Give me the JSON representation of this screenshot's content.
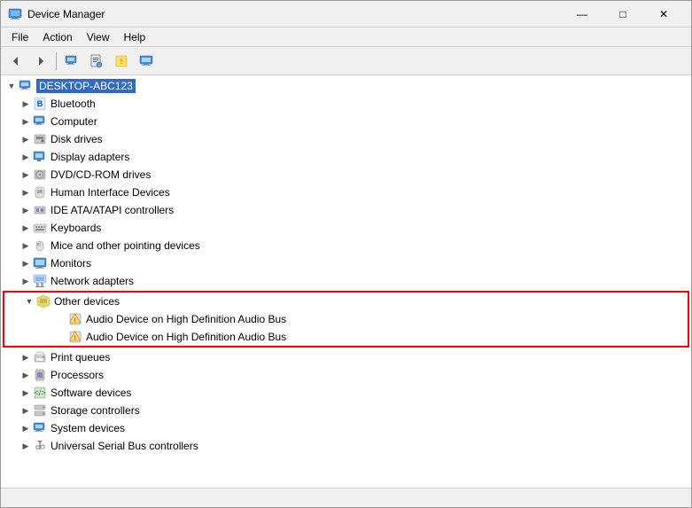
{
  "window": {
    "title": "Device Manager",
    "icon": "device-manager-icon"
  },
  "title_buttons": {
    "minimize": "—",
    "maximize": "□",
    "close": "✕"
  },
  "menu": {
    "items": [
      "File",
      "Action",
      "View",
      "Help"
    ]
  },
  "toolbar": {
    "buttons": [
      {
        "name": "back-btn",
        "icon": "◀"
      },
      {
        "name": "forward-btn",
        "icon": "▶"
      },
      {
        "name": "device-manager-btn",
        "icon": "🖥"
      },
      {
        "name": "properties-btn",
        "icon": "ℹ"
      },
      {
        "name": "update-driver-btn",
        "icon": "📋"
      },
      {
        "name": "monitor-btn",
        "icon": "🖥"
      }
    ]
  },
  "tree": {
    "root": "DESKTOP-ABC123",
    "items": [
      {
        "id": "bluetooth",
        "label": "Bluetooth",
        "level": 1,
        "expanded": false,
        "icon": "bluetooth"
      },
      {
        "id": "computer",
        "label": "Computer",
        "level": 1,
        "expanded": false,
        "icon": "computer"
      },
      {
        "id": "disk-drives",
        "label": "Disk drives",
        "level": 1,
        "expanded": false,
        "icon": "disk"
      },
      {
        "id": "display-adapters",
        "label": "Display adapters",
        "level": 1,
        "expanded": false,
        "icon": "display"
      },
      {
        "id": "dvd-cdrom",
        "label": "DVD/CD-ROM drives",
        "level": 1,
        "expanded": false,
        "icon": "dvd"
      },
      {
        "id": "hid",
        "label": "Human Interface Devices",
        "level": 1,
        "expanded": false,
        "icon": "hid"
      },
      {
        "id": "ide",
        "label": "IDE ATA/ATAPI controllers",
        "level": 1,
        "expanded": false,
        "icon": "ide"
      },
      {
        "id": "keyboards",
        "label": "Keyboards",
        "level": 1,
        "expanded": false,
        "icon": "keyboard"
      },
      {
        "id": "mice",
        "label": "Mice and other pointing devices",
        "level": 1,
        "expanded": false,
        "icon": "mouse"
      },
      {
        "id": "monitors",
        "label": "Monitors",
        "level": 1,
        "expanded": false,
        "icon": "monitor"
      },
      {
        "id": "network",
        "label": "Network adapters",
        "level": 1,
        "expanded": false,
        "icon": "network"
      },
      {
        "id": "other-devices",
        "label": "Other devices",
        "level": 1,
        "expanded": true,
        "icon": "folder-open"
      },
      {
        "id": "audio-device-1",
        "label": "Audio Device on High Definition Audio Bus",
        "level": 2,
        "expanded": false,
        "icon": "warning-device",
        "highlighted": true
      },
      {
        "id": "audio-device-2",
        "label": "Audio Device on High Definition Audio Bus",
        "level": 2,
        "expanded": false,
        "icon": "warning-device",
        "highlighted": true
      },
      {
        "id": "print-queues",
        "label": "Print queues",
        "level": 1,
        "expanded": false,
        "icon": "printer"
      },
      {
        "id": "processors",
        "label": "Processors",
        "level": 1,
        "expanded": false,
        "icon": "processor"
      },
      {
        "id": "software-devices",
        "label": "Software devices",
        "level": 1,
        "expanded": false,
        "icon": "software"
      },
      {
        "id": "storage-controllers",
        "label": "Storage controllers",
        "level": 1,
        "expanded": false,
        "icon": "storage"
      },
      {
        "id": "system-devices",
        "label": "System devices",
        "level": 1,
        "expanded": false,
        "icon": "system"
      },
      {
        "id": "usb-controllers",
        "label": "Universal Serial Bus controllers",
        "level": 1,
        "expanded": false,
        "icon": "usb"
      }
    ]
  },
  "status": ""
}
